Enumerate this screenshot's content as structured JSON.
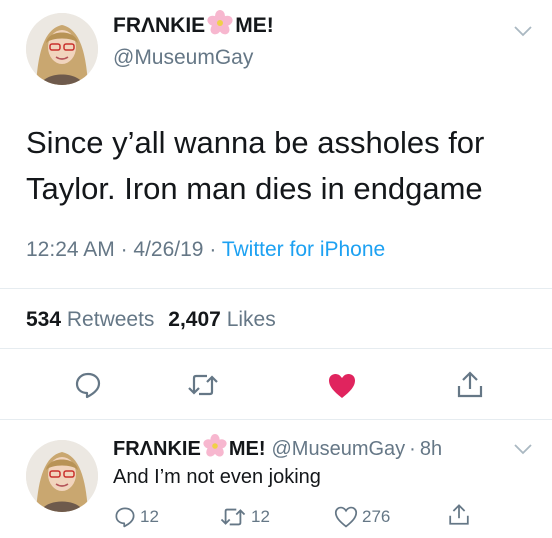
{
  "main_tweet": {
    "display_name_start": "FR",
    "display_name_a": "Λ",
    "display_name_mid": "NKIE",
    "display_name_end": "ME!",
    "handle": "@MuseumGay",
    "text_line1": "Since y’all wanna be assholes for",
    "text_line2": "Taylor. Iron man dies in endgame",
    "time": "12:24 AM",
    "date": "4/26/19",
    "source": "Twitter for iPhone",
    "sep": "·",
    "retweets_count": "534",
    "retweets_label": "Retweets",
    "likes_count": "2,407",
    "likes_label": "Likes",
    "liked": true,
    "like_color": "#e0245e"
  },
  "reply_tweet": {
    "display_name_start": "FR",
    "display_name_a": "Λ",
    "display_name_mid": "NKIE",
    "display_name_end": "ME!",
    "handle": "@MuseumGay",
    "sep": "·",
    "age": "8h",
    "text": "And I’m not even joking",
    "reply_count": "12",
    "retweet_count": "12",
    "like_count": "276"
  },
  "icons": {
    "flower": "cherry-blossom-emoji",
    "chevron": "chevron-down-icon",
    "reply": "reply-icon",
    "retweet": "retweet-icon",
    "like": "heart-icon",
    "share": "share-icon"
  }
}
